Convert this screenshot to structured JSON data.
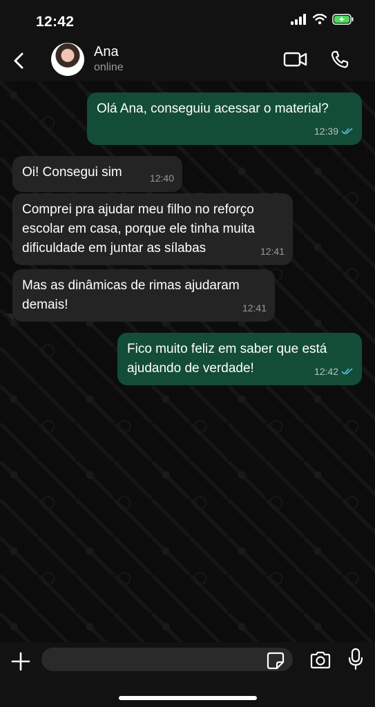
{
  "status_bar": {
    "time": "12:42"
  },
  "contact": {
    "name": "Ana",
    "status": "online"
  },
  "messages": [
    {
      "direction": "out",
      "text": "Olá Ana, conseguiu acessar o material?",
      "time": "12:39",
      "read": true
    },
    {
      "direction": "in",
      "text": "Oi! Consegui sim",
      "time": "12:40"
    },
    {
      "direction": "in",
      "text": "Comprei pra ajudar meu filho no reforço escolar em casa, porque ele tinha muita dificuldade em juntar as sílabas",
      "time": "12:41"
    },
    {
      "direction": "in",
      "text": "Mas as dinâmicas de rimas ajudaram demais!",
      "time": "12:41"
    },
    {
      "direction": "out",
      "text": "Fico muito feliz em saber que está ajudando de verdade!",
      "time": "12:42",
      "read": true
    }
  ],
  "input": {
    "value": "",
    "placeholder": ""
  },
  "colors": {
    "outgoing_bubble": "#144d37",
    "incoming_bubble": "#242424",
    "read_ticks": "#53bdeb",
    "battery": "#4cd964"
  }
}
